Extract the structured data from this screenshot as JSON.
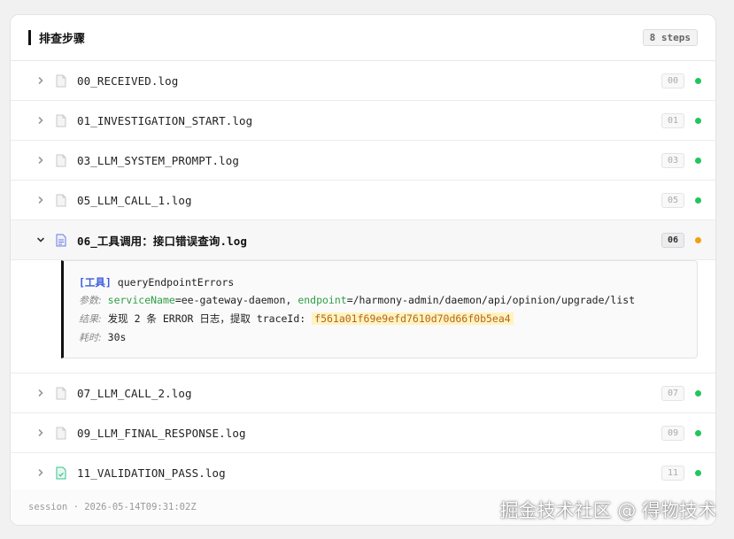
{
  "header": {
    "title": "排查步骤",
    "steps_badge": "8 steps"
  },
  "colors": {
    "success": "#22c55e",
    "running": "#f59e0b",
    "tool_file_icon": "#6b7bd8",
    "pass_file_icon": "#34c38f"
  },
  "rows_before": [
    {
      "file": "00_RECEIVED.log",
      "num": "00",
      "status": "success",
      "icon": "file-icon"
    },
    {
      "file": "01_INVESTIGATION_START.log",
      "num": "01",
      "status": "success",
      "icon": "file-icon"
    },
    {
      "file": "03_LLM_SYSTEM_PROMPT.log",
      "num": "03",
      "status": "success",
      "icon": "file-icon"
    },
    {
      "file": "05_LLM_CALL_1.log",
      "num": "05",
      "status": "success",
      "icon": "file-icon"
    }
  ],
  "active_row": {
    "file": "06_工具调用：接口错误查询.log",
    "num": "06",
    "status": "running",
    "icon": "file-text-icon",
    "detail": {
      "tool_tag": "[工具]",
      "tool_name": "queryEndpointErrors",
      "params_label": "参数:",
      "param1_key": "serviceName",
      "param1_val": "=ee-gateway-daemon, ",
      "param2_key": "endpoint",
      "param2_val": "=/harmony-admin/daemon/api/opinion/upgrade/list",
      "result_label": "结果:",
      "result_text": "发现 2 条 ERROR 日志，提取 traceId: ",
      "trace_id": "f561a01f69e9efd7610d70d66f0b5ea4",
      "duration_label": "耗时:",
      "duration": "30s"
    }
  },
  "rows_after": [
    {
      "file": "07_LLM_CALL_2.log",
      "num": "07",
      "status": "success",
      "icon": "file-icon"
    },
    {
      "file": "09_LLM_FINAL_RESPONSE.log",
      "num": "09",
      "status": "success",
      "icon": "file-icon"
    },
    {
      "file": "11_VALIDATION_PASS.log",
      "num": "11",
      "status": "success",
      "icon": "file-check-icon"
    }
  ],
  "footer": {
    "session": "session · 2026-05-14T09:31:02Z"
  },
  "watermark": "掘金技术社区 @ 得物技术"
}
